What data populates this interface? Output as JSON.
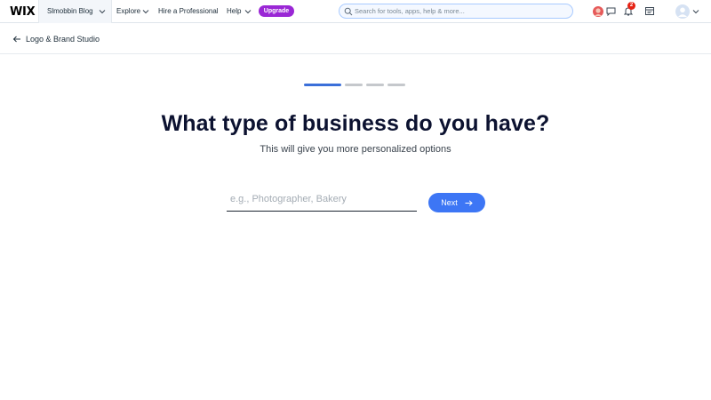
{
  "topbar": {
    "logo": "WIX",
    "site_name": "Slmobbin Blog",
    "nav": {
      "explore": "Explore",
      "hire": "Hire a Professional",
      "help": "Help"
    },
    "upgrade_label": "Upgrade",
    "search_placeholder": "Search for tools, apps, help & more...",
    "notification_count": "2",
    "accent": "#9a27d5"
  },
  "subheader": {
    "back_label": "Logo & Brand Studio"
  },
  "progress": {
    "steps": 4,
    "current": 1,
    "color_active": "#3b6fd9"
  },
  "main": {
    "heading": "What type of business do you have?",
    "subtitle": "This will give you more personalized options",
    "input_placeholder": "e.g., Photographer, Bakery",
    "input_value": "",
    "next_label": "Next",
    "button_color": "#3d76f5"
  }
}
